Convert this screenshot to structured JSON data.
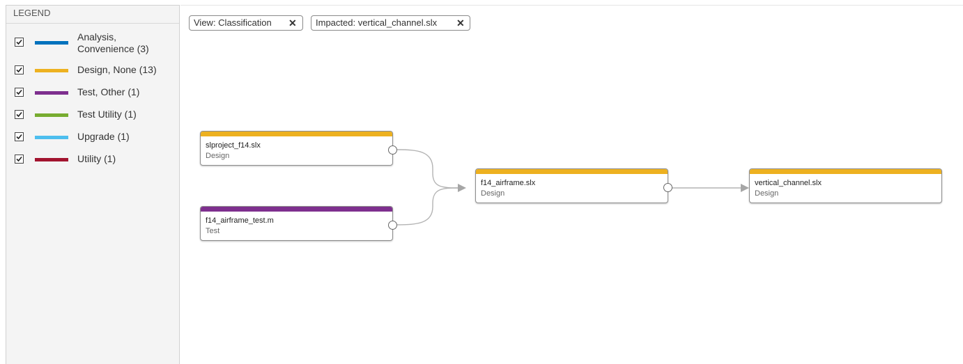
{
  "legend": {
    "header": "LEGEND",
    "items": [
      {
        "label_line1": "Analysis,",
        "label_line2": "Convenience (3)",
        "color": "#0072bd",
        "checked": true
      },
      {
        "label_line1": "Design, None (13)",
        "label_line2": "",
        "color": "#edb120",
        "checked": true
      },
      {
        "label_line1": "Test, Other (1)",
        "label_line2": "",
        "color": "#7e2f8e",
        "checked": true
      },
      {
        "label_line1": "Test Utility (1)",
        "label_line2": "",
        "color": "#77ac30",
        "checked": true
      },
      {
        "label_line1": "Upgrade (1)",
        "label_line2": "",
        "color": "#4dbeee",
        "checked": true
      },
      {
        "label_line1": "Utility (1)",
        "label_line2": "",
        "color": "#a2142f",
        "checked": true
      }
    ]
  },
  "filters": {
    "view_chip": "View: Classification",
    "impacted_chip": "Impacted: vertical_channel.slx",
    "close_glyph": "✕"
  },
  "graph": {
    "nodes": [
      {
        "name": "slproject_f14.slx",
        "classification": "Design",
        "color": "#edb120"
      },
      {
        "name": "f14_airframe_test.m",
        "classification": "Test",
        "color": "#7e2f8e"
      },
      {
        "name": "f14_airframe.slx",
        "classification": "Design",
        "color": "#edb120"
      },
      {
        "name": "vertical_channel.slx",
        "classification": "Design",
        "color": "#edb120"
      }
    ],
    "edges": [
      {
        "from": "slproject_f14.slx",
        "to": "f14_airframe.slx"
      },
      {
        "from": "f14_airframe_test.m",
        "to": "f14_airframe.slx"
      },
      {
        "from": "f14_airframe.slx",
        "to": "vertical_channel.slx"
      }
    ]
  }
}
